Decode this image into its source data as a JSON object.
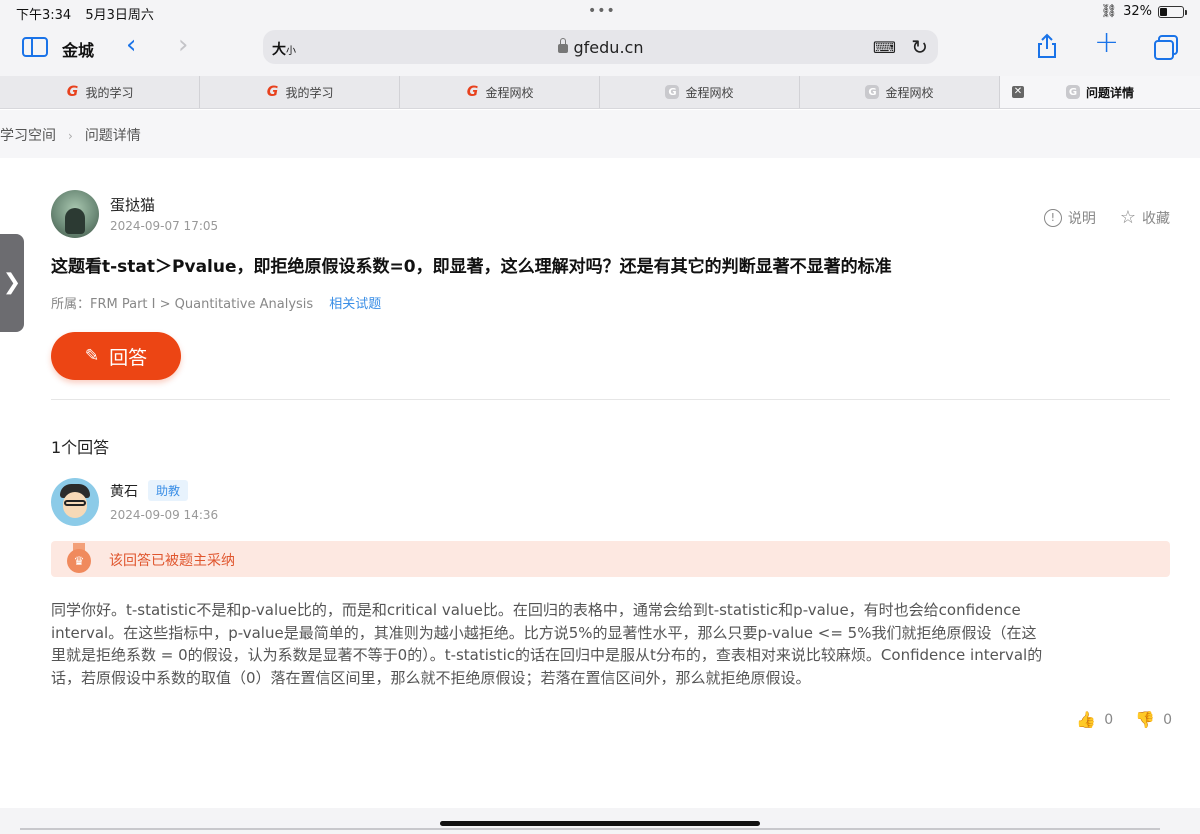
{
  "status": {
    "time": "下午3:34",
    "date": "5月3日周六",
    "battery": "32%",
    "battery_level": 0.32
  },
  "toolbar": {
    "tab_group": "金城",
    "address_size_big": "大",
    "address_size_small": "小",
    "url": "gfedu.cn"
  },
  "tabs": [
    {
      "label": "我的学习",
      "favicon": "gfedu-logo"
    },
    {
      "label": "我的学习",
      "favicon": "gfedu-logo"
    },
    {
      "label": "金程网校",
      "favicon": "gfedu-logo"
    },
    {
      "label": "金程网校",
      "favicon": "generic-g"
    },
    {
      "label": "金程网校",
      "favicon": "generic-g"
    },
    {
      "label": "问题详情",
      "favicon": "generic-g",
      "active": true
    }
  ],
  "breadcrumb": {
    "root": "学习空间",
    "current": "问题详情"
  },
  "question": {
    "author": "蛋挞猫",
    "time": "2024-09-07 17:05",
    "explain_label": "说明",
    "favorite_label": "收藏",
    "title": "这题看t-stat＞Pvalue，即拒绝原假设系数=0，即显著，这么理解对吗？还是有其它的判断显著不显著的标准",
    "category": "所属：FRM Part I > Quantitative Analysis",
    "related_link": "相关试题",
    "answer_button": "回答"
  },
  "answers": {
    "count_label": "1个回答",
    "items": [
      {
        "author": "黄石",
        "role_badge": "助教",
        "time": "2024-09-09 14:36",
        "accepted_label": "该回答已被题主采纳",
        "body": "同学你好。t-statistic不是和p-value比的，而是和critical value比。在回归的表格中，通常会给到t-statistic和p-value，有时也会给confidence interval。在这些指标中，p-value是最简单的，其准则为越小越拒绝。比方说5%的显著性水平，那么只要p-value <= 5%我们就拒绝原假设（在这里就是拒绝系数 = 0的假设，认为系数是显著不等于0的）。t-statistic的话在回归中是服从t分布的，查表相对来说比较麻烦。Confidence interval的话，若原假设中系数的取值（0）落在置信区间里，那么就不拒绝原假设；若落在置信区间外，那么就拒绝原假设。",
        "likes": "0",
        "dislikes": "0"
      }
    ]
  },
  "colors": {
    "accent": "#ec4514",
    "link": "#3a8ee6",
    "accepted_bg": "#fde8e1",
    "ios_blue": "#1a73e8"
  }
}
